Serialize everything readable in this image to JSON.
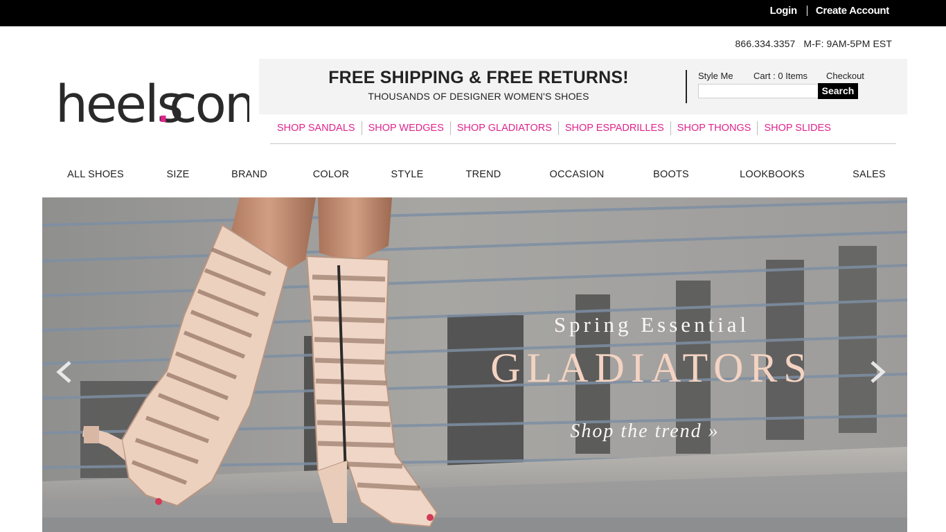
{
  "topbar": {
    "login": "Login",
    "create_account": "Create Account"
  },
  "contact": {
    "phone": "866.334.3357",
    "hours": "M-F: 9AM-5PM EST"
  },
  "logo": {
    "text_main": "heels",
    "dot": ".",
    "text_tail": "com",
    "dot_color": "#e0238c"
  },
  "promo": {
    "headline": "FREE SHIPPING & FREE RETURNS!",
    "subline": "THOUSANDS OF DESIGNER WOMEN'S SHOES"
  },
  "account": {
    "style_me": "Style Me",
    "cart": "Cart : 0 Items",
    "checkout": "Checkout",
    "search_value": "",
    "search_button": "Search"
  },
  "shop_links": [
    "SHOP SANDALS",
    "SHOP WEDGES",
    "SHOP GLADIATORS",
    "SHOP ESPADRILLES",
    "SHOP THONGS",
    "SHOP SLIDES"
  ],
  "main_nav": [
    "ALL SHOES",
    "SIZE",
    "BRAND",
    "COLOR",
    "STYLE",
    "TREND",
    "OCCASION",
    "BOOTS",
    "LOOKBOOKS",
    "SALES"
  ],
  "hero": {
    "eyebrow": "Spring Essential",
    "title": "GLADIATORS",
    "cta": "Shop the trend »",
    "prev_icon": "chevron-left-icon",
    "next_icon": "chevron-right-icon"
  },
  "colors": {
    "accent_pink": "#e0238c",
    "topbar": "#000000",
    "promo_bg": "#f3f3f3"
  }
}
